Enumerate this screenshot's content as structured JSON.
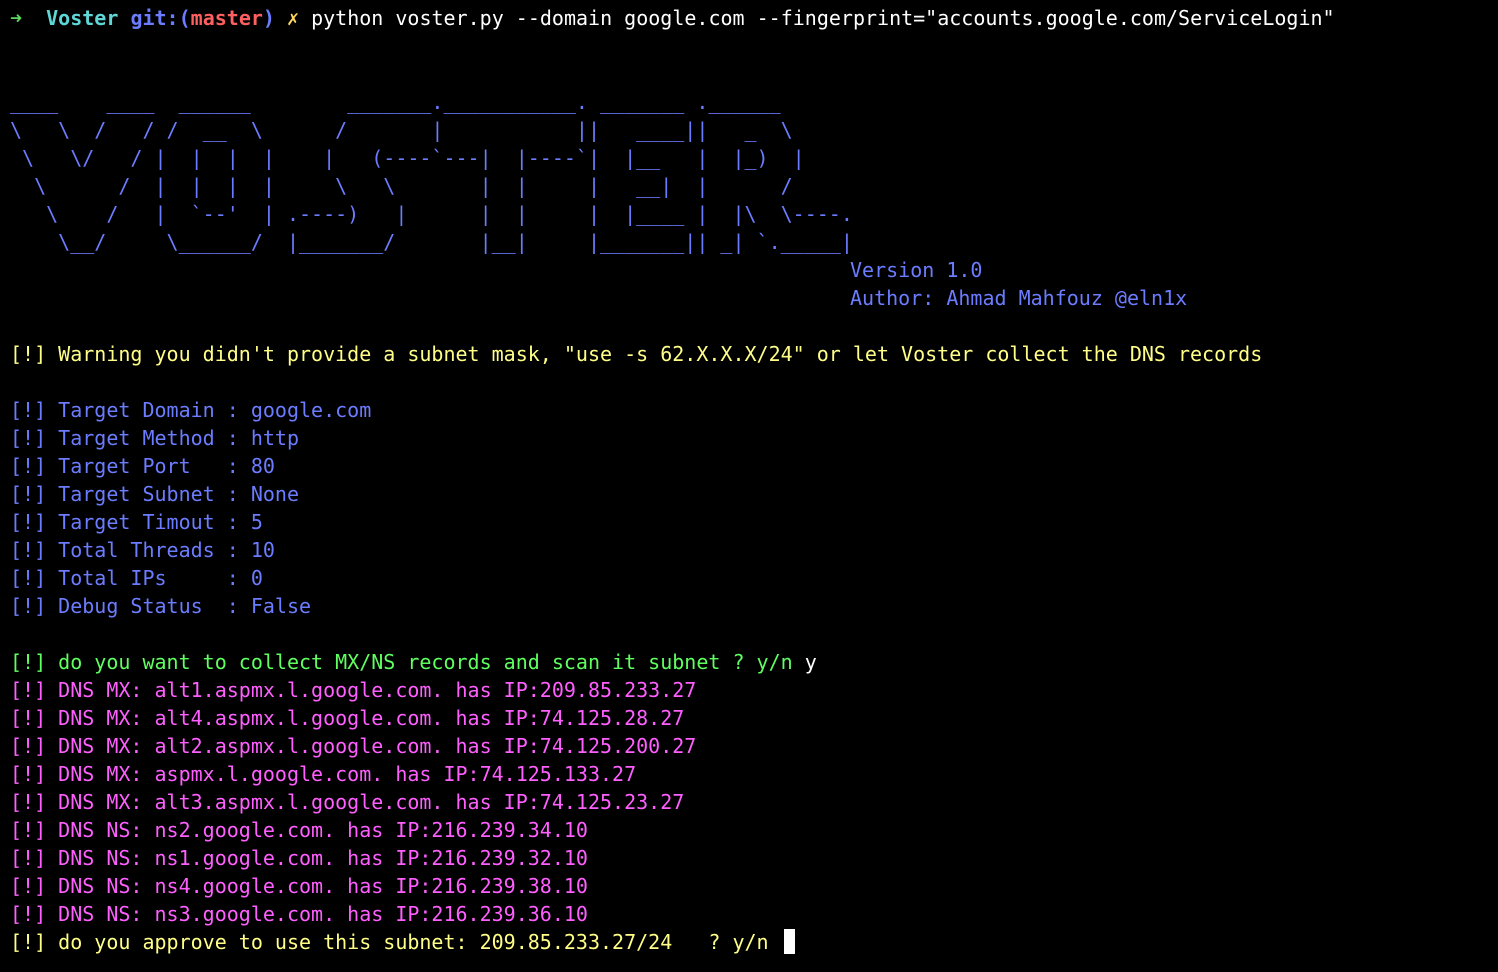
{
  "prompt": {
    "arrow": "➜",
    "dir": "Voster",
    "git_label": "git:(",
    "branch": "master",
    "git_close": ")",
    "dirty_mark": "✗",
    "command": "python voster.py --domain google.com --fingerprint=\"accounts.google.com/ServiceLogin\""
  },
  "banner": {
    "ascii_art": "____    ____  ______        _______.___________. _______ .______\n\\   \\  /   / /  __  \\      /       |           ||   ____||   _  \\\n \\   \\/   / |  |  |  |    |   (----`---|  |----`|  |__   |  |_)  |\n  \\      /  |  |  |  |     \\   \\       |  |     |   __|  |      /\n   \\    /   |  `--'  | .----)   |      |  |     |  |____ |  |\\  \\----.\n    \\__/     \\______/  |_______/       |__|     |_______|| _| `._____|",
    "version": "Version 1.0",
    "author": "Author: Ahmad Mahfouz @eln1x"
  },
  "warning": "[!] Warning you didn't provide a subnet mask, \"use -s 62.X.X.X/24\" or let Voster collect the DNS records",
  "config": [
    "[!] Target Domain : google.com",
    "[!] Target Method : http",
    "[!] Target Port   : 80",
    "[!] Target Subnet : None",
    "[!] Target Timout : 5",
    "[!] Total Threads : 10",
    "[!] Total IPs     : 0",
    "[!] Debug Status  : False"
  ],
  "question": {
    "text": "[!] do you want to collect MX/NS records and scan it subnet ? y/n",
    "answer": " y"
  },
  "dns_records": [
    "[!] DNS MX: alt1.aspmx.l.google.com. has IP:209.85.233.27",
    "[!] DNS MX: alt4.aspmx.l.google.com. has IP:74.125.28.27",
    "[!] DNS MX: alt2.aspmx.l.google.com. has IP:74.125.200.27",
    "[!] DNS MX: aspmx.l.google.com. has IP:74.125.133.27",
    "[!] DNS MX: alt3.aspmx.l.google.com. has IP:74.125.23.27",
    "[!] DNS NS: ns2.google.com. has IP:216.239.34.10",
    "[!] DNS NS: ns1.google.com. has IP:216.239.32.10",
    "[!] DNS NS: ns4.google.com. has IP:216.239.38.10",
    "[!] DNS NS: ns3.google.com. has IP:216.239.36.10"
  ],
  "approve": {
    "text": "[!] do you approve to use this subnet: 209.85.233.27/24   ? y/n"
  },
  "colors": {
    "background": "#000000",
    "prompt_arrow": "#5fd75f",
    "prompt_dir": "#5fd7d7",
    "banner_blue": "#6c7cff",
    "warning_yellow": "#ffff87",
    "question_green": "#5fff5f",
    "dns_magenta": "#ff5fff"
  }
}
